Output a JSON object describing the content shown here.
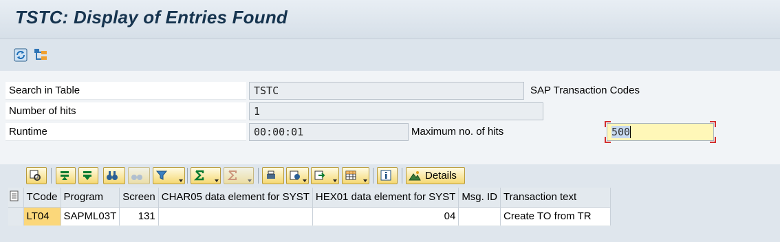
{
  "window": {
    "title": "TSTC: Display of Entries Found"
  },
  "toolbar": {
    "icons": [
      "refresh-icon",
      "hierarchy-icon"
    ]
  },
  "selection": {
    "search_table_label": "Search in Table",
    "search_table_value": "TSTC",
    "search_table_desc": "SAP Transaction Codes",
    "hits_label": "Number of hits",
    "hits_value": "1",
    "runtime_label": "Runtime",
    "runtime_value": "00:00:01",
    "max_hits_label": "Maximum no. of hits",
    "max_hits_value": "500"
  },
  "alv_toolbar": {
    "details_label": "Details"
  },
  "grid": {
    "columns": [
      "TCode",
      "Program",
      "Screen",
      "CHAR05 data element for SYST",
      "HEX01 data element for SYST",
      "Msg. ID",
      "Transaction text"
    ],
    "rows": [
      [
        "LT04",
        "SAPML03T",
        "131",
        "",
        "04",
        "",
        "Create TO from TR"
      ]
    ]
  },
  "colors": {
    "title": "#16344f",
    "key_cell": "#fbd77a",
    "edit_field": "#fff7b8",
    "focus_corner": "#d32f2f"
  }
}
